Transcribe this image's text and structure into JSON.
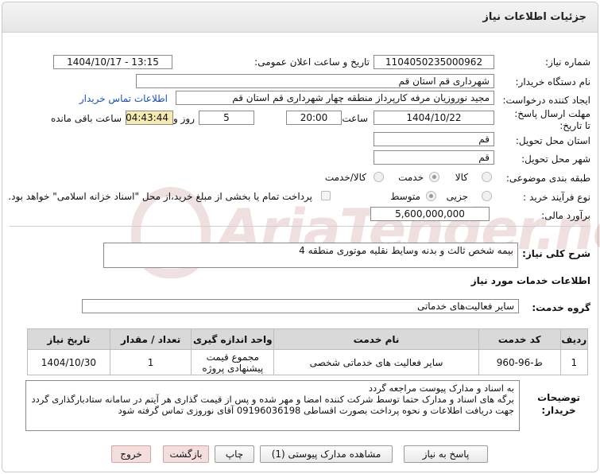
{
  "header": {
    "title": "جزئیات اطلاعات نیاز"
  },
  "fields": {
    "need_number_label": "شماره نیاز:",
    "need_number": "1104050235000962",
    "announce_label": "تاریخ و ساعت اعلان عمومی:",
    "announce_value": "1404/10/17 - 13:15",
    "buyer_label": "نام دستگاه خریدار:",
    "buyer_value": "شهرداری قم استان قم",
    "creator_label": "ایجاد کننده درخواست:",
    "creator_value": "مجید نوروزیان مرفه کارپرداز منطقه چهار شهرداری قم استان قم",
    "contact_link": "اطلاعات تماس خریدار",
    "deadline_label": "مهلت ارسال پاسخ: تا تاریخ:",
    "deadline_date": "1404/10/22",
    "hour_label": "ساعت",
    "deadline_time": "20:00",
    "days_value": "5",
    "days_label": "روز و",
    "remaining_value": "04:43:44",
    "remaining_label": "ساعت باقی مانده",
    "province_label": "استان محل تحویل:",
    "province_value": "قم",
    "city_label": "شهر محل تحویل:",
    "city_value": "قم",
    "category_label": "طبقه بندی موضوعی:",
    "category_options": [
      "کالا",
      "خدمت",
      "کالا/خدمت"
    ],
    "category_selected": "خدمت",
    "process_label": "نوع فرآیند خرید :",
    "process_options": [
      "جزیی",
      "متوسط"
    ],
    "process_selected": "متوسط",
    "payment_note": "پرداخت تمام یا بخشی از مبلغ خرید،از محل \"اسناد خزانه اسلامی\" خواهد بود.",
    "budget_label": "برآورد مالی:",
    "budget_value": "5,600,000,000"
  },
  "summary": {
    "label": "شرح کلی نیاز:",
    "value": "بیمه شخص ثالث و بدنه وسایط نقلیه موتوری منطقه 4"
  },
  "services": {
    "section_title": "اطلاعات خدمات مورد نیاز",
    "group_label": "گروه خدمت:",
    "group_value": "سایر فعالیت‌های خدماتی"
  },
  "table": {
    "headers": [
      "ردیف",
      "کد خدمت",
      "نام خدمت",
      "واحد اندازه گیری",
      "تعداد / مقدار",
      "تاریخ نیاز"
    ],
    "rows": [
      {
        "row": "1",
        "code": "ط-96-960",
        "name": "سایر فعالیت های خدماتی شخصی",
        "unit_line1": "مجموع قیمت",
        "unit_line2": "پیشنهادی پروژه",
        "qty": "1",
        "date": "1404/10/30"
      }
    ]
  },
  "notes": {
    "label": "توضیحات خریدار:",
    "lines": [
      "به اسناد و مدارک پیوست مراجعه گردد",
      "برگه های اسناد و مدارک حتما توسط شرکت کننده امضا و مهر شده و پس از قیمت گذاری هر آیتم در سامانه ستادبارگذاری گردد",
      "جهت دریافت اطلاعات و نحوه پرداخت بصورت اقساطی 09196036198 آقای نوروزی تماس گرفته شود"
    ]
  },
  "buttons": {
    "reply": "پاسخ به نیاز",
    "attachments": "مشاهده مدارک پیوستی (1)",
    "print": "چاپ",
    "back": "بازگشت",
    "exit": "خروج"
  },
  "watermark": {
    "text": "AriaTender.net"
  }
}
